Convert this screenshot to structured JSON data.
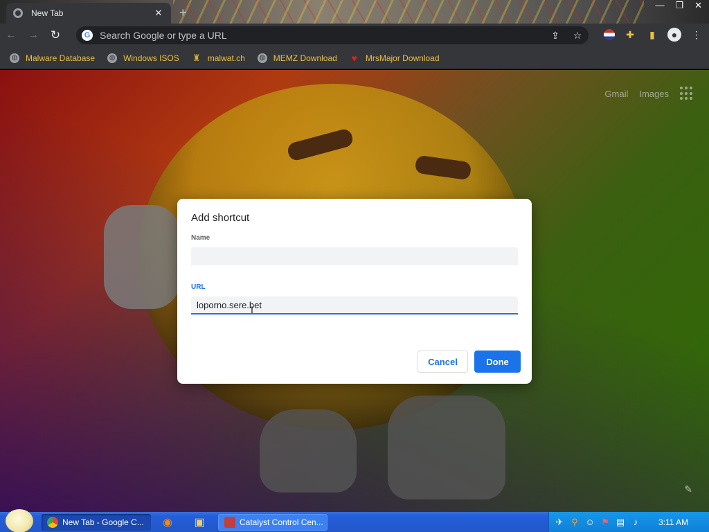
{
  "browser": {
    "tab_title": "New Tab",
    "tab_close": "✕",
    "new_tab": "+",
    "window_controls": [
      "—",
      "❐",
      "✕"
    ],
    "omnibox_placeholder": "Search Google or type a URL",
    "nav": {
      "back": "←",
      "forward": "→",
      "reload": "↻"
    }
  },
  "bookmarks": [
    {
      "label": "Malware Database",
      "icon": "globe-icon"
    },
    {
      "label": "Windows ISOS",
      "icon": "globe-icon"
    },
    {
      "label": "malwat.ch",
      "icon": "hat-icon"
    },
    {
      "label": "MEMZ Download",
      "icon": "globe-icon"
    },
    {
      "label": "MrsMajor Download",
      "icon": "heart-icon"
    }
  ],
  "newtab": {
    "links": {
      "gmail": "Gmail",
      "images": "Images"
    }
  },
  "dialog": {
    "title": "Add shortcut",
    "name_label": "Name",
    "name_value": "",
    "url_label": "URL",
    "url_value": "loporno.sere.bet",
    "cancel_label": "Cancel",
    "done_label": "Done"
  },
  "taskbar": {
    "items": [
      {
        "label": "New Tab - Google C...",
        "state": "active"
      },
      {
        "label": "Catalyst Control Cen...",
        "state": "normal"
      }
    ],
    "clock": "3:11 AM"
  },
  "colors": {
    "accent": "#1a73e8",
    "bookmark_text": "#e8c040"
  }
}
